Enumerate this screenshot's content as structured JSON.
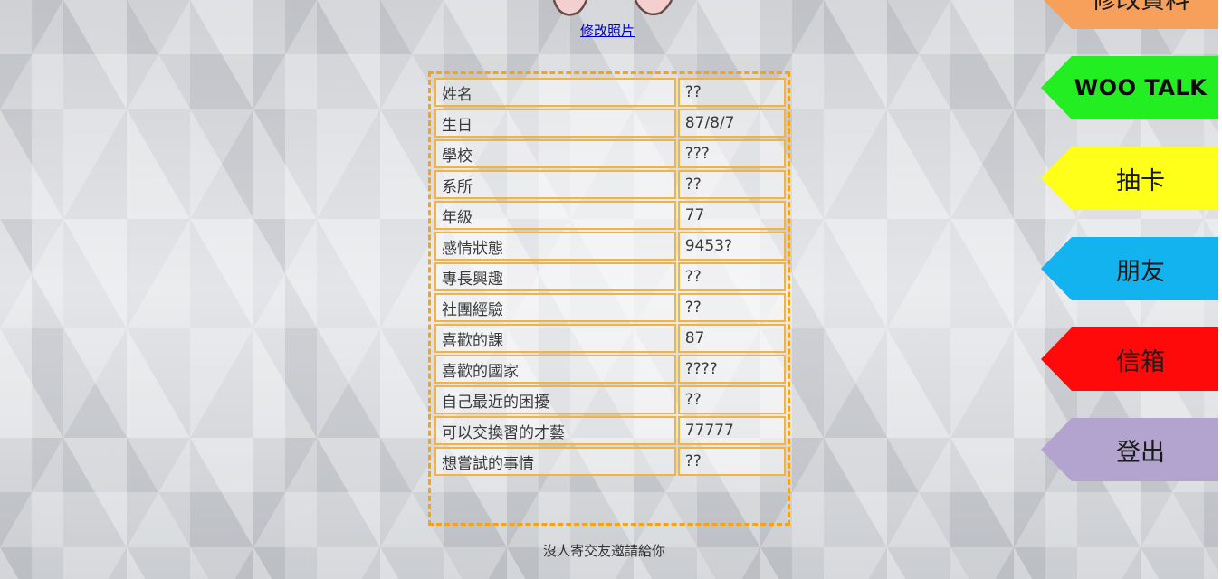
{
  "header": {
    "photo_link": "修改照片"
  },
  "profile": {
    "rows": [
      {
        "field": "姓名",
        "value": "??"
      },
      {
        "field": "生日",
        "value": "87/8/7"
      },
      {
        "field": "學校",
        "value": "???"
      },
      {
        "field": "系所",
        "value": "??"
      },
      {
        "field": "年級",
        "value": "77"
      },
      {
        "field": "感情狀態",
        "value": "9453?"
      },
      {
        "field": "專長興趣",
        "value": "??"
      },
      {
        "field": "社團經驗",
        "value": "??"
      },
      {
        "field": "喜歡的課",
        "value": "87"
      },
      {
        "field": "喜歡的國家",
        "value": "????"
      },
      {
        "field": "自己最近的困擾",
        "value": "??"
      },
      {
        "field": "可以交換習的才藝",
        "value": "77777"
      },
      {
        "field": "想嘗試的事情",
        "value": "??"
      }
    ]
  },
  "invites": {
    "empty_text": "沒人寄交友邀請給你"
  },
  "nav": {
    "items": [
      {
        "label": "修改資料",
        "color": "#f7a05c"
      },
      {
        "label": "WOO TALK",
        "color": "#22ee22"
      },
      {
        "label": "抽卡",
        "color": "#ffff1a"
      },
      {
        "label": "朋友",
        "color": "#13b3f0"
      },
      {
        "label": "信箱",
        "color": "#ff0a0a"
      },
      {
        "label": "登出",
        "color": "#b3a3cf"
      }
    ]
  }
}
